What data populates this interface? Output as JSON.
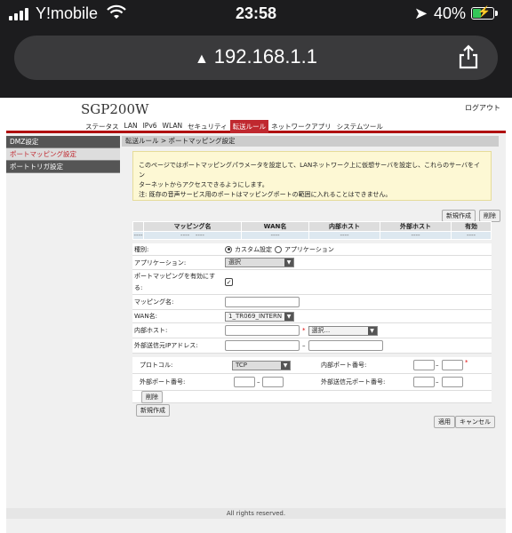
{
  "status_bar": {
    "carrier": "Y!mobile",
    "time": "23:58",
    "battery": "40%"
  },
  "browser": {
    "url": "192.168.1.1"
  },
  "router": {
    "brand": "SGP200W",
    "logout": "ログアウト",
    "nav": [
      "ステータス",
      "LAN",
      "IPv6",
      "WLAN",
      "セキュリティ",
      "転送ルール",
      "ネットワークアプリ",
      "システムツール"
    ],
    "sidebar": [
      "DMZ設定",
      "ポートマッピング設定",
      "ポートトリガ設定"
    ],
    "breadcrumb": "転送ルール > ポートマッピング設定",
    "notice_line1": "このページではポートマッピングパラメータを設定して、LANネットワーク上に仮想サーバを設定し、これらのサーバをイン",
    "notice_line2": "ターネットからアクセスできるようにします。",
    "notice_line3": "注: 既存の音声サービス用のポートはマッピングポートの範囲に入れることはできません。",
    "btn_new": "新規作成",
    "btn_delete": "削除",
    "table_headers": [
      "マッピング名",
      "WAN名",
      "内部ホスト",
      "外部ホスト",
      "有効"
    ],
    "table_row": [
      "----",
      "----",
      "----",
      "----",
      "----",
      "----",
      "----"
    ],
    "form": {
      "type_label": "種別:",
      "type_opt1": "カスタム設定",
      "type_opt2": "アプリケーション",
      "app_label": "アプリケーション:",
      "app_value": "選択",
      "enable_label": "ポートマッピングを有効にす",
      "enable_label2": "る:",
      "enable_mark": "✓",
      "mapping_name_label": "マッピング名:",
      "mapping_name_value": "",
      "wan_label": "WAN名:",
      "wan_value": "1_TR069_INTERN",
      "internal_host_label": "内部ホスト:",
      "internal_host_value": "",
      "internal_host_select": "選択...",
      "external_ip_label": "外部送信元IPアドレス:",
      "external_ip_value": "",
      "external_ip_value2": ""
    },
    "proto": {
      "protocol_label": "プロトコル:",
      "protocol_value": "TCP",
      "internal_port_label": "内部ポート番号:",
      "internal_port_from": "",
      "internal_port_to": "",
      "external_port_label": "外部ポート番号:",
      "external_port_from": "",
      "external_port_to": "",
      "source_port_label": "外部送信元ポート番号:",
      "source_port_from": "",
      "source_port_to": "",
      "delete": "削除"
    },
    "btn_new_bottom": "新規作成",
    "btn_apply": "適用",
    "btn_cancel": "キャンセル",
    "footer": "All rights reserved."
  }
}
